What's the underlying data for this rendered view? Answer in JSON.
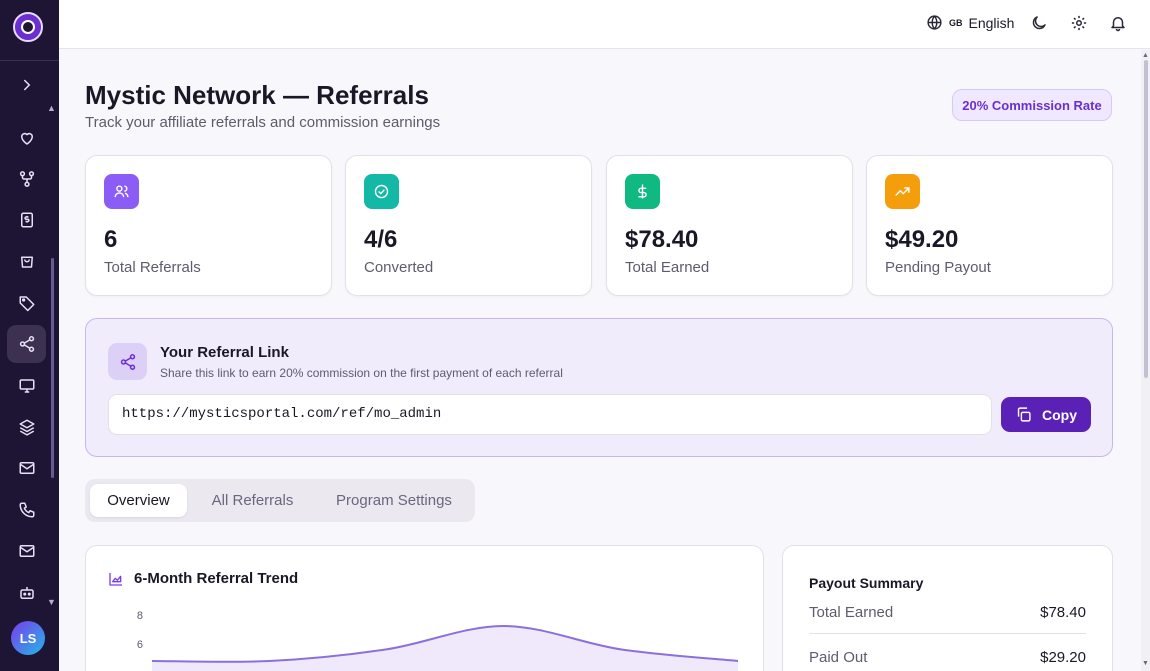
{
  "header": {
    "language_flag": "GB",
    "language": "English"
  },
  "sidebar": {
    "avatar_initials": "LS",
    "items": [
      "expand-icon",
      "heart-icon",
      "network-icon",
      "billing-icon",
      "store-icon",
      "tag-icon",
      "share-icon",
      "monitor-icon",
      "layers-icon",
      "mail-icon",
      "phone-icon",
      "inbox-icon",
      "bot-icon"
    ],
    "active_item": "share-icon"
  },
  "page": {
    "title": "Mystic Network — Referrals",
    "subtitle": "Track your affiliate referrals and commission earnings",
    "commission_badge": "20% Commission Rate"
  },
  "stats": [
    {
      "value": "6",
      "label": "Total Referrals",
      "icon": "users-icon",
      "color": "#8b5cf6"
    },
    {
      "value": "4/6",
      "label": "Converted",
      "icon": "check-circle-icon",
      "color": "#14b8a6"
    },
    {
      "value": "$78.40",
      "label": "Total Earned",
      "icon": "dollar-icon",
      "color": "#10b981"
    },
    {
      "value": "$49.20",
      "label": "Pending Payout",
      "icon": "trending-up-icon",
      "color": "#f59e0b"
    }
  ],
  "referral": {
    "title": "Your Referral Link",
    "description": "Share this link to earn 20% commission on the first payment of each referral",
    "link": "https://mysticsportal.com/ref/mo_admin",
    "copy_label": "Copy"
  },
  "tabs": [
    {
      "label": "Overview",
      "active": true
    },
    {
      "label": "All Referrals",
      "active": false
    },
    {
      "label": "Program Settings",
      "active": false
    }
  ],
  "trend": {
    "title": "6-Month Referral Trend"
  },
  "chart_data": {
    "type": "area",
    "title": "6-Month Referral Trend",
    "yticks": [
      "8",
      "6"
    ],
    "ylim": [
      0,
      8
    ],
    "series": [
      {
        "values": [
          0,
          0,
          1,
          3,
          1,
          0
        ]
      }
    ]
  },
  "payout": {
    "title": "Payout Summary",
    "rows": [
      {
        "label": "Total Earned",
        "value": "$78.40"
      },
      {
        "label": "Paid Out",
        "value": "$29.20"
      }
    ]
  }
}
